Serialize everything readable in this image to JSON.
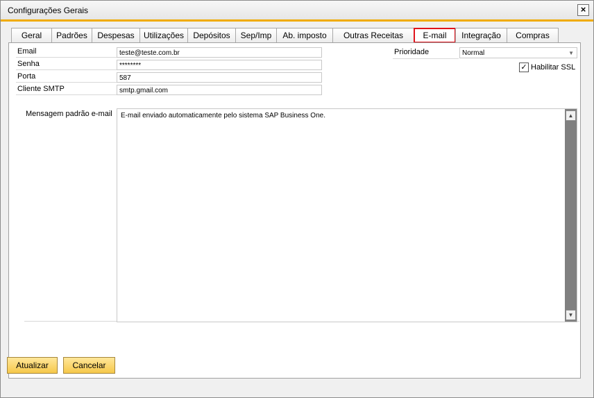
{
  "window": {
    "title": "Configurações Gerais",
    "close_label": "×"
  },
  "tabs": [
    {
      "label": "Geral"
    },
    {
      "label": "Padrões"
    },
    {
      "label": "Despesas"
    },
    {
      "label": "Utilizações"
    },
    {
      "label": "Depósitos"
    },
    {
      "label": "Sep/Imp"
    },
    {
      "label": "Ab. imposto"
    },
    {
      "label": "Outras Receitas"
    },
    {
      "label": "E-mail"
    },
    {
      "label": "Integração"
    },
    {
      "label": "Compras"
    }
  ],
  "form": {
    "email": {
      "label": "Email",
      "value": "teste@teste.com.br"
    },
    "senha": {
      "label": "Senha",
      "value": "********"
    },
    "porta": {
      "label": "Porta",
      "value": "587"
    },
    "smtp": {
      "label": "Cliente SMTP",
      "value": "smtp.gmail.com"
    },
    "prioridade": {
      "label": "Prioridade",
      "value": "Normal"
    },
    "ssl": {
      "label": "Habilitar SSL",
      "checked": true,
      "mark": "✓"
    },
    "mensagem": {
      "label": "Mensagem padrão e-mail",
      "value": "E-mail enviado automaticamente pelo sistema SAP Business One."
    }
  },
  "buttons": {
    "update": "Atualizar",
    "cancel": "Cancelar"
  },
  "colors": {
    "accent": "#f0ab00",
    "active_tab_border": "#e0141c",
    "button_fill": "#f6c84a"
  }
}
